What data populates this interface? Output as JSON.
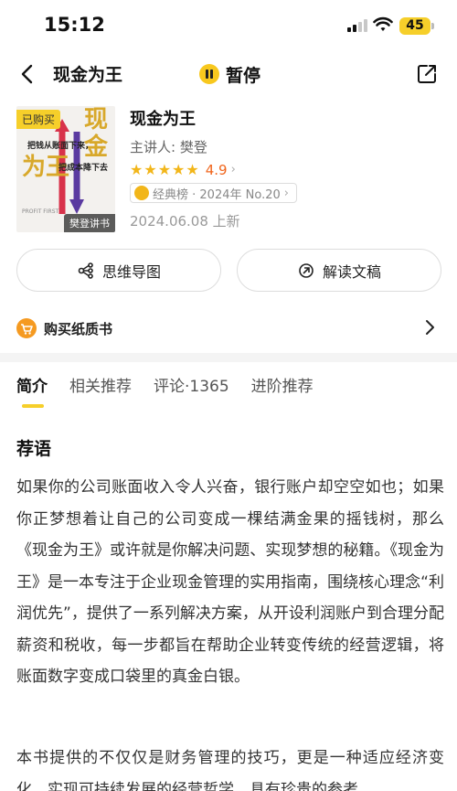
{
  "status_bar": {
    "time": "15:12",
    "battery": "45"
  },
  "nav": {
    "title": "现金为王",
    "pause_label": "暂停"
  },
  "book": {
    "ribbon": "已购买",
    "cover_title_top": "现金",
    "cover_title_bottom": "为王",
    "cover_line1": "把钱从账面下来，",
    "cover_line2": "把成本降下去",
    "cover_en": "PROFIT FIRST",
    "cover_tag": "樊登讲书",
    "title": "现金为王",
    "author": "主讲人: 樊登",
    "rating": "4.9",
    "star_count": 5,
    "rank": "经典榜 · 2024年 No.20",
    "date": "2024.06.08 上新"
  },
  "actions": {
    "mindmap": "思维导图",
    "transcript": "解读文稿"
  },
  "buy": {
    "label": "购买纸质书"
  },
  "tabs": [
    {
      "label": "简介",
      "active": true
    },
    {
      "label": "相关推荐",
      "active": false
    },
    {
      "label": "评论·1365",
      "active": false
    },
    {
      "label": "进阶推荐",
      "active": false
    }
  ],
  "content": {
    "section_title": "荐语",
    "paragraph1": "如果你的公司账面收入令人兴奋，银行账户却空空如也；如果你正梦想着让自己的公司变成一棵结满金果的摇钱树，那么《现金为王》或许就是你解决问题、实现梦想的秘籍。《现金为王》是一本专注于企业现金管理的实用指南，围绕核心理念“利润优先”，提供了一系列解决方案，从开设利润账户到合理分配薪资和税收，每一步都旨在帮助企业转变传统的经营逻辑，将账面数字变成口袋里的真金白银。",
    "paragraph2": "本书提供的不仅仅是财务管理的技巧，更是一种适应经济变化，实现可持续发展的经营哲学，具有珍贵的参考"
  },
  "colors": {
    "accent": "#f6cf2a",
    "rating": "#f0651c",
    "star": "#f2b61a"
  }
}
